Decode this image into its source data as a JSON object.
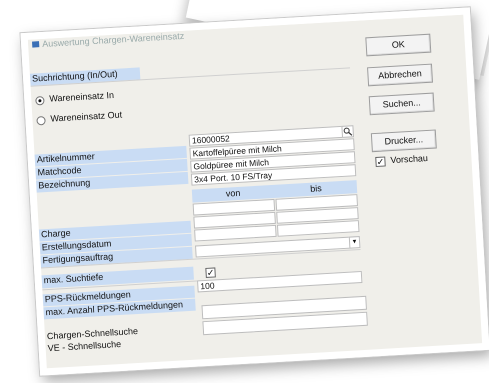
{
  "window": {
    "title": "Auswertung Chargen-Wareneinsatz"
  },
  "direction": {
    "group_label": "Suchrichtung (In/Out)",
    "options": [
      {
        "label": "Wareneinsatz In",
        "selected": true
      },
      {
        "label": "Wareneinsatz Out",
        "selected": false
      }
    ]
  },
  "article": {
    "number_label": "Artikelnummer",
    "number_value": "16000052",
    "matchcode_label": "Matchcode",
    "matchcode_value": "Kartoffelpüree mit Milch",
    "description_label": "Bezeichnung",
    "description_value": "Goldpüree mit Milch",
    "extra_value": "3x4 Port. 10 FS/Tray"
  },
  "range": {
    "from_header": "von",
    "to_header": "bis",
    "rows": [
      {
        "label": "Charge",
        "from": "",
        "to": ""
      },
      {
        "label": "Erstellungsdatum",
        "from": "",
        "to": ""
      },
      {
        "label": "Fertigungsauftrag",
        "from": "",
        "to": ""
      }
    ]
  },
  "search_depth": {
    "label": "max. Suchtiefe",
    "value": ""
  },
  "pps": {
    "feedback_label": "PPS-Rückmeldungen",
    "feedback_checked": true,
    "max_label": "max. Anzahl PPS-Rückmeldungen",
    "max_value": "100"
  },
  "quick": {
    "charge_label": "Chargen-Schnellsuche",
    "ve_label": "VE - Schnellsuche"
  },
  "buttons": {
    "ok": "OK",
    "cancel": "Abbrechen",
    "search": "Suchen...",
    "print": "Drucker..."
  },
  "preview": {
    "label": "Vorschau",
    "checked": true
  },
  "icons": {
    "search": "magnifier-icon",
    "dropdown": "dropdown-arrow-icon",
    "title": "window-icon"
  }
}
